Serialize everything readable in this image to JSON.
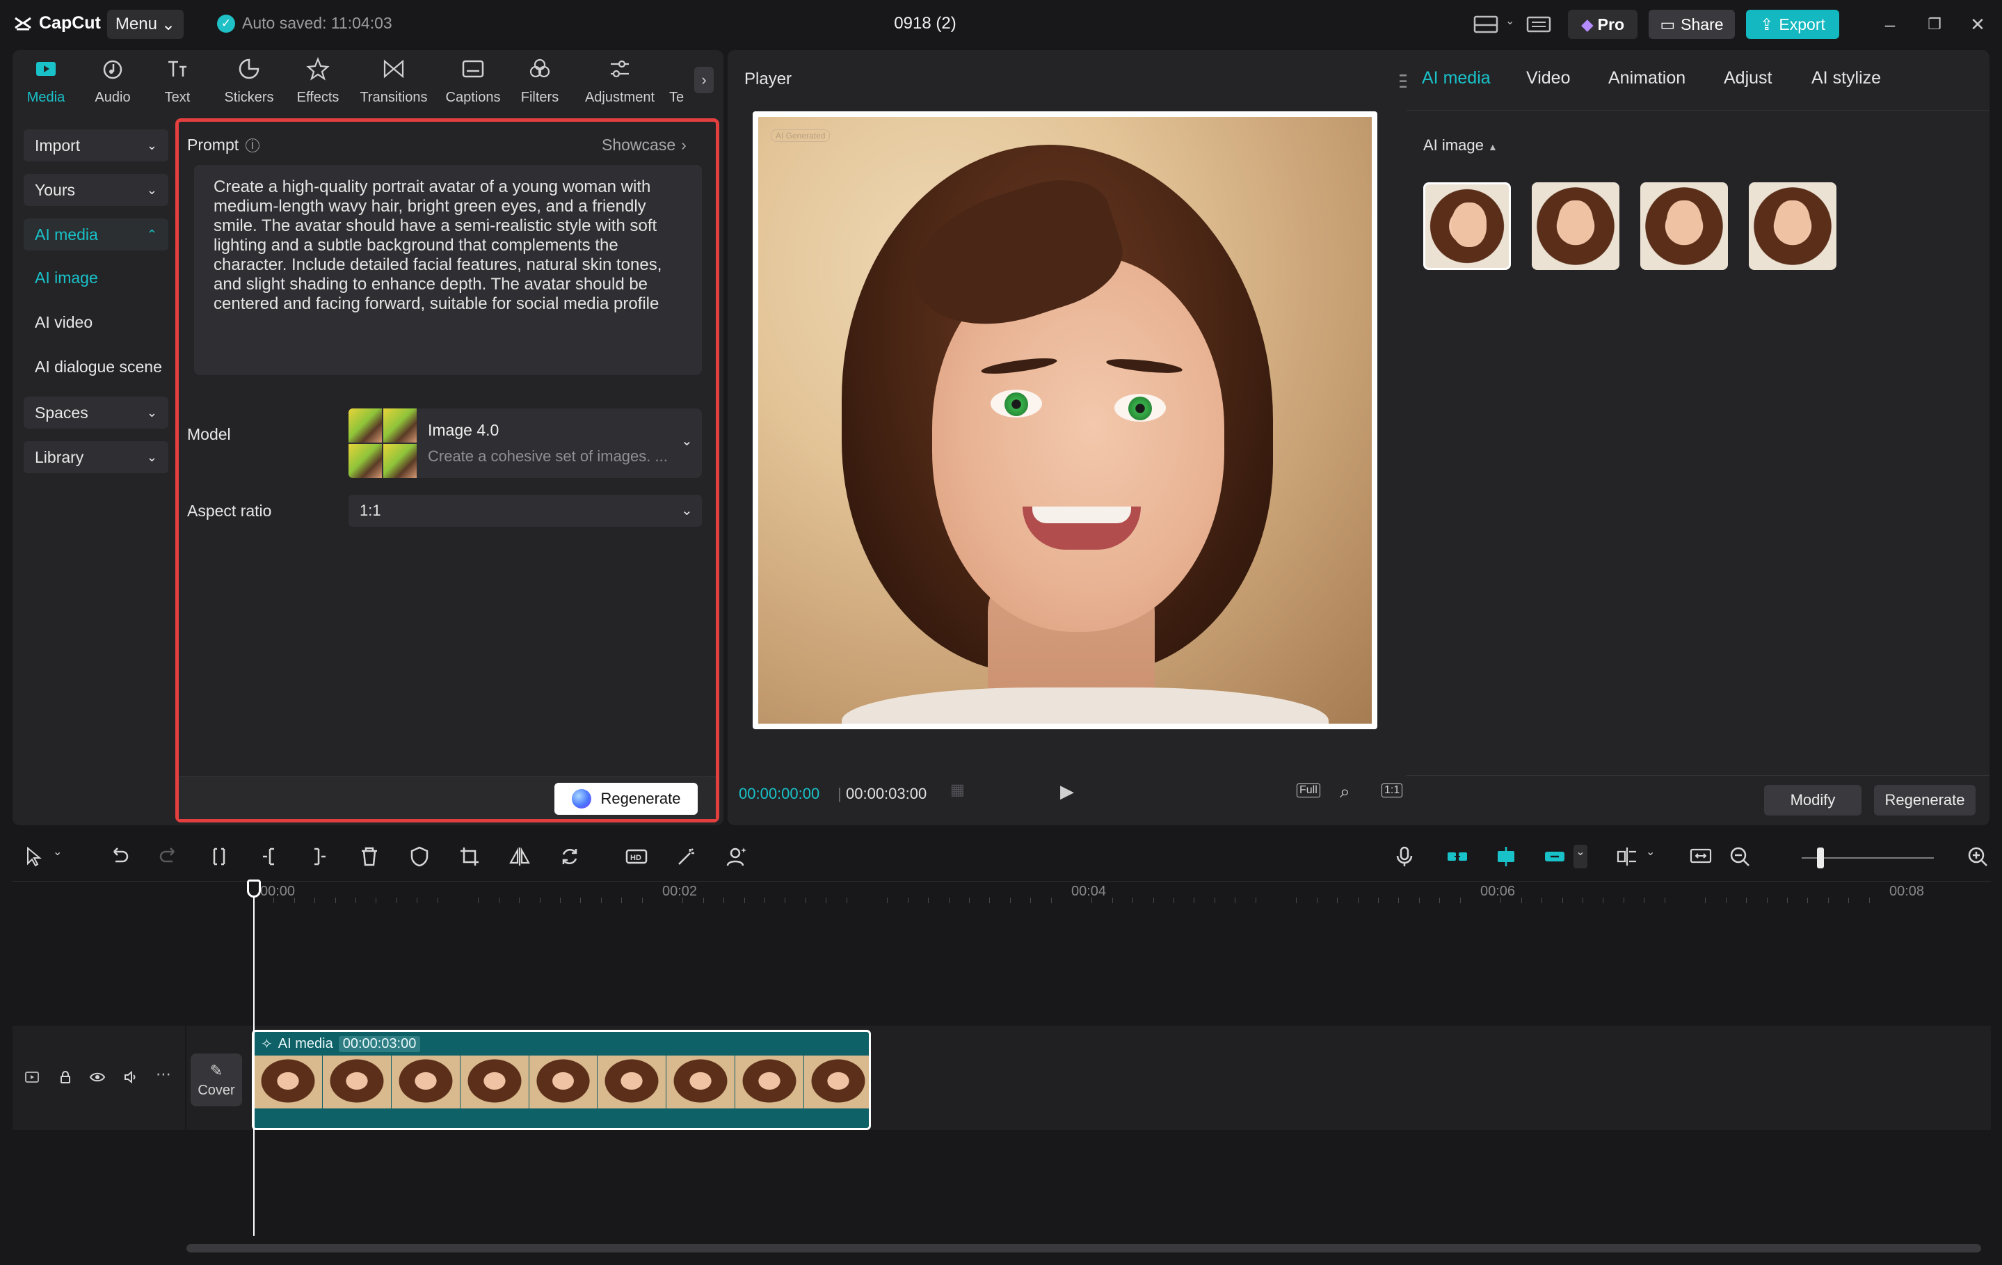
{
  "app": {
    "name": "CapCut",
    "menu_label": "Menu",
    "autosave": "Auto saved: 11:04:03",
    "project_title": "0918 (2)",
    "pro_label": "Pro",
    "share_label": "Share",
    "export_label": "Export",
    "accent_color": "#19c2c9"
  },
  "toolbar": {
    "items": [
      {
        "label": "Media",
        "icon": "media-icon",
        "active": true
      },
      {
        "label": "Audio",
        "icon": "audio-icon"
      },
      {
        "label": "Text",
        "icon": "text-icon"
      },
      {
        "label": "Stickers",
        "icon": "stickers-icon"
      },
      {
        "label": "Effects",
        "icon": "effects-icon"
      },
      {
        "label": "Transitions",
        "icon": "transitions-icon"
      },
      {
        "label": "Captions",
        "icon": "captions-icon"
      },
      {
        "label": "Filters",
        "icon": "filters-icon"
      },
      {
        "label": "Adjustment",
        "icon": "adjustment-icon"
      },
      {
        "label": "Te",
        "icon": "template-icon"
      }
    ]
  },
  "sidebar": {
    "import": "Import",
    "yours": "Yours",
    "ai_media": "AI media",
    "ai_image": "AI image",
    "ai_video": "AI video",
    "ai_dialogue": "AI dialogue scene",
    "spaces": "Spaces",
    "library": "Library"
  },
  "prompt_panel": {
    "prompt_label": "Prompt",
    "showcase": "Showcase",
    "prompt_text": "Create a high-quality portrait avatar of a young woman with medium-length wavy hair, bright green eyes, and a friendly smile. The avatar should have a semi-realistic style with soft lighting and a subtle background that complements the character. Include detailed facial features, natural skin tones, and slight shading to enhance depth. The avatar should be centered and facing forward, suitable for social media profile",
    "model_label": "Model",
    "model_name": "Image 4.0",
    "model_desc": "Create a cohesive set of images. ...",
    "aspect_label": "Aspect ratio",
    "aspect_value": "1:1",
    "regenerate": "Regenerate"
  },
  "player": {
    "title": "Player",
    "current_time": "00:00:00:00",
    "separator": "|",
    "total_time": "00:00:03:00",
    "watermark": "AI Generated",
    "full_label": "Full",
    "ratio_label": "1:1"
  },
  "right_panel": {
    "tabs": [
      "AI media",
      "Video",
      "Animation",
      "Adjust",
      "AI stylize"
    ],
    "section_label": "AI image",
    "modify": "Modify",
    "regenerate": "Regenerate"
  },
  "timeline": {
    "ticks": [
      "00:00",
      "00:02",
      "00:04",
      "00:06",
      "00:08"
    ],
    "cover_label": "Cover",
    "clip_label": "AI media",
    "clip_duration": "00:00:03:00"
  }
}
